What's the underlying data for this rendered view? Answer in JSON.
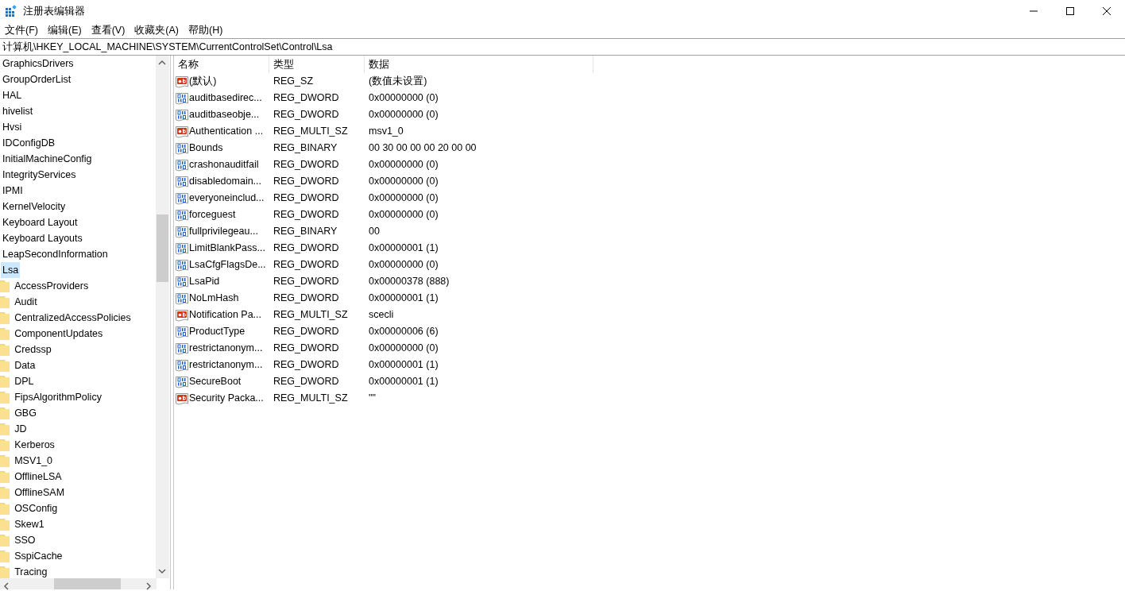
{
  "window": {
    "title": "注册表编辑器"
  },
  "menu": [
    "文件(F)",
    "编辑(E)",
    "查看(V)",
    "收藏夹(A)",
    "帮助(H)"
  ],
  "address": "计算机\\HKEY_LOCAL_MACHINE\\SYSTEM\\CurrentControlSet\\Control\\Lsa",
  "tree": [
    {
      "label": "GraphicsDrivers",
      "selected": false
    },
    {
      "label": "GroupOrderList",
      "selected": false
    },
    {
      "label": "HAL",
      "selected": false
    },
    {
      "label": "hivelist",
      "selected": false
    },
    {
      "label": "Hvsi",
      "selected": false
    },
    {
      "label": "IDConfigDB",
      "selected": false
    },
    {
      "label": "InitialMachineConfig",
      "selected": false
    },
    {
      "label": "IntegrityServices",
      "selected": false
    },
    {
      "label": "IPMI",
      "selected": false
    },
    {
      "label": "KernelVelocity",
      "selected": false
    },
    {
      "label": "Keyboard Layout",
      "selected": false
    },
    {
      "label": "Keyboard Layouts",
      "selected": false
    },
    {
      "label": "LeapSecondInformation",
      "selected": false
    },
    {
      "label": "Lsa",
      "selected": true,
      "children": [
        {
          "label": "AccessProviders",
          "selected": false
        },
        {
          "label": "Audit",
          "selected": false
        },
        {
          "label": "CentralizedAccessPolicies",
          "selected": false
        },
        {
          "label": "ComponentUpdates",
          "selected": false
        },
        {
          "label": "Credssp",
          "selected": false
        },
        {
          "label": "Data",
          "selected": false
        },
        {
          "label": "DPL",
          "selected": false
        },
        {
          "label": "FipsAlgorithmPolicy",
          "selected": false
        },
        {
          "label": "GBG",
          "selected": false
        },
        {
          "label": "JD",
          "selected": false
        },
        {
          "label": "Kerberos",
          "selected": false
        },
        {
          "label": "MSV1_0",
          "selected": false
        },
        {
          "label": "OfflineLSA",
          "selected": false
        },
        {
          "label": "OfflineSAM",
          "selected": false
        },
        {
          "label": "OSConfig",
          "selected": false
        },
        {
          "label": "Skew1",
          "selected": false
        },
        {
          "label": "SSO",
          "selected": false
        },
        {
          "label": "SspiCache",
          "selected": false
        },
        {
          "label": "Tracing",
          "selected": false
        }
      ]
    }
  ],
  "table": {
    "columns": [
      "名称",
      "类型",
      "数据"
    ],
    "rows": [
      {
        "kind": "string",
        "name": "(默认)",
        "type": "REG_SZ",
        "data": "(数值未设置)"
      },
      {
        "kind": "binary",
        "name": "auditbasedirec...",
        "type": "REG_DWORD",
        "data": "0x00000000 (0)"
      },
      {
        "kind": "binary",
        "name": "auditbaseobje...",
        "type": "REG_DWORD",
        "data": "0x00000000 (0)"
      },
      {
        "kind": "string",
        "name": "Authentication ...",
        "type": "REG_MULTI_SZ",
        "data": "msv1_0"
      },
      {
        "kind": "binary",
        "name": "Bounds",
        "type": "REG_BINARY",
        "data": "00 30 00 00 00 20 00 00"
      },
      {
        "kind": "binary",
        "name": "crashonauditfail",
        "type": "REG_DWORD",
        "data": "0x00000000 (0)"
      },
      {
        "kind": "binary",
        "name": "disabledomain...",
        "type": "REG_DWORD",
        "data": "0x00000000 (0)"
      },
      {
        "kind": "binary",
        "name": "everyoneinclud...",
        "type": "REG_DWORD",
        "data": "0x00000000 (0)"
      },
      {
        "kind": "binary",
        "name": "forceguest",
        "type": "REG_DWORD",
        "data": "0x00000000 (0)"
      },
      {
        "kind": "binary",
        "name": "fullprivilegeau...",
        "type": "REG_BINARY",
        "data": "00"
      },
      {
        "kind": "binary",
        "name": "LimitBlankPass...",
        "type": "REG_DWORD",
        "data": "0x00000001 (1)"
      },
      {
        "kind": "binary",
        "name": "LsaCfgFlagsDe...",
        "type": "REG_DWORD",
        "data": "0x00000000 (0)"
      },
      {
        "kind": "binary",
        "name": "LsaPid",
        "type": "REG_DWORD",
        "data": "0x00000378 (888)"
      },
      {
        "kind": "binary",
        "name": "NoLmHash",
        "type": "REG_DWORD",
        "data": "0x00000001 (1)"
      },
      {
        "kind": "string",
        "name": "Notification Pa...",
        "type": "REG_MULTI_SZ",
        "data": "scecli"
      },
      {
        "kind": "binary",
        "name": "ProductType",
        "type": "REG_DWORD",
        "data": "0x00000006 (6)"
      },
      {
        "kind": "binary",
        "name": "restrictanonym...",
        "type": "REG_DWORD",
        "data": "0x00000000 (0)"
      },
      {
        "kind": "binary",
        "name": "restrictanonym...",
        "type": "REG_DWORD",
        "data": "0x00000001 (1)"
      },
      {
        "kind": "binary",
        "name": "SecureBoot",
        "type": "REG_DWORD",
        "data": "0x00000001 (1)"
      },
      {
        "kind": "string",
        "name": "Security Packa...",
        "type": "REG_MULTI_SZ",
        "data": "\"\""
      }
    ]
  }
}
